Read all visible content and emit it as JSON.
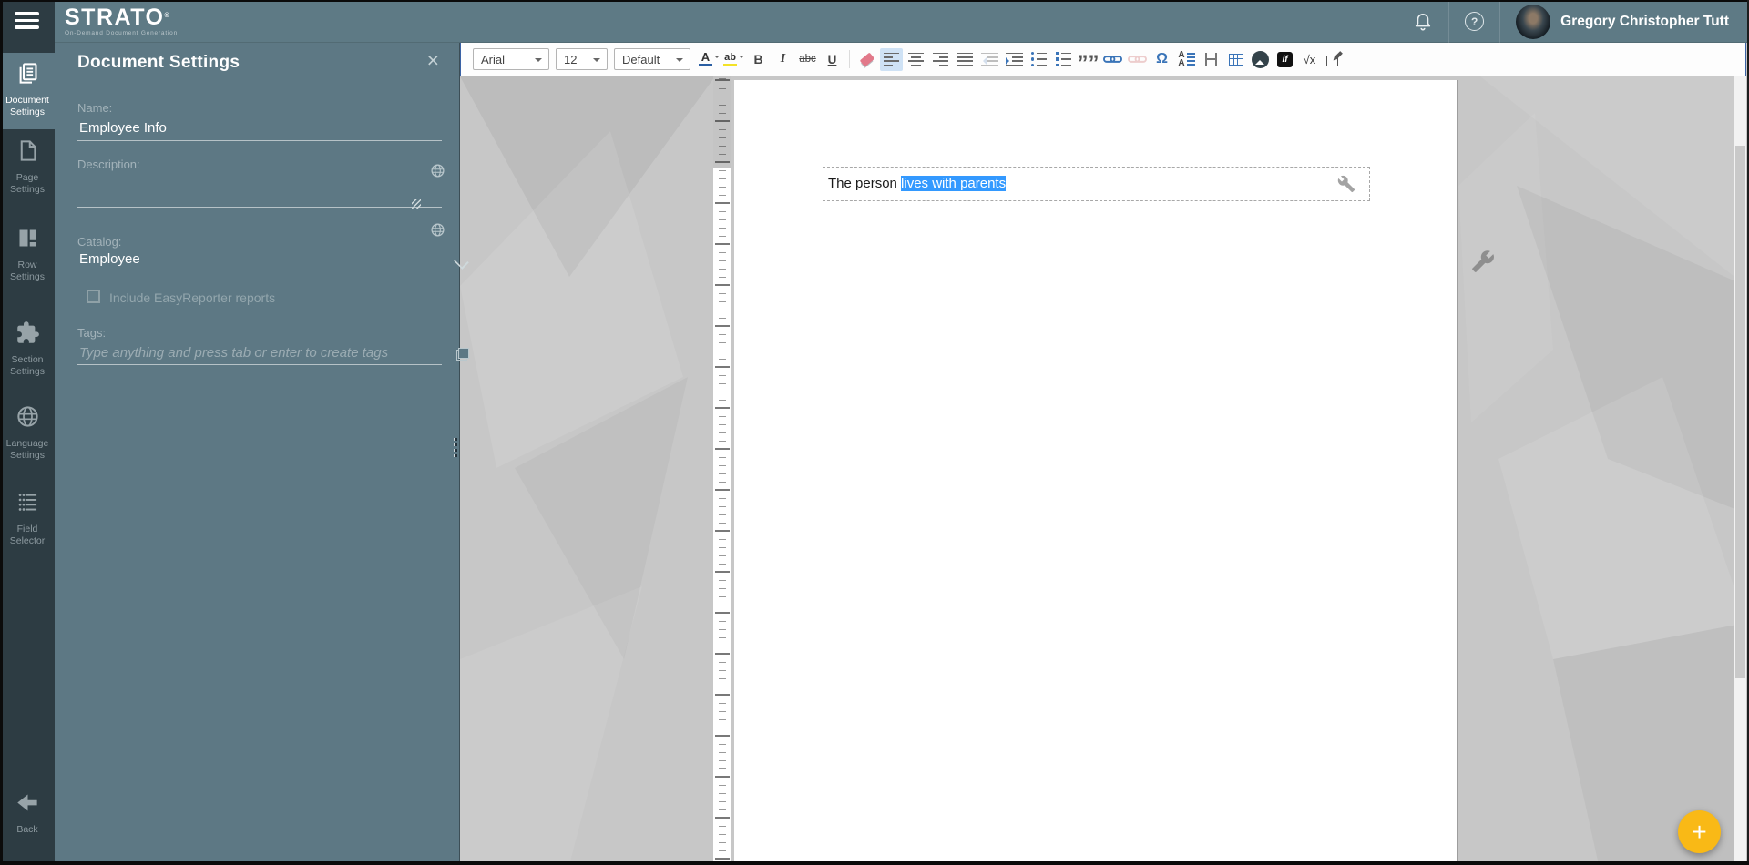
{
  "topbar": {
    "logo_title": "STRATO",
    "logo_tm": "®",
    "logo_subtitle": "On-Demand Document Generation",
    "user_name": "Gregory Christopher Tutt",
    "help_glyph": "?"
  },
  "sidebar": {
    "items": [
      {
        "l1": "Document",
        "l2": "Settings"
      },
      {
        "l1": "Page",
        "l2": "Settings"
      },
      {
        "l1": "Row",
        "l2": "Settings"
      },
      {
        "l1": "Section",
        "l2": "Settings"
      },
      {
        "l1": "Language",
        "l2": "Settings"
      },
      {
        "l1": "Field",
        "l2": "Selector"
      }
    ],
    "back_label": "Back"
  },
  "panel": {
    "title": "Document Settings",
    "close_glyph": "×",
    "name_label": "Name:",
    "name_value": "Employee Info",
    "description_label": "Description:",
    "description_value": "",
    "catalog_label": "Catalog:",
    "catalog_value": "Employee",
    "checkbox_label": "Include EasyReporter reports",
    "checkbox_checked": false,
    "tags_label": "Tags:",
    "tags_placeholder": "Type anything and press tab or enter to create tags"
  },
  "toolbar": {
    "font_family": "Arial",
    "font_size": "12",
    "paragraph_style": "Default",
    "fontcolor_glyph": "A",
    "highlight_glyph": "ab",
    "bold_glyph": "B",
    "italic_glyph": "I",
    "strike_glyph": "abc",
    "underline_glyph": "U",
    "quote_glyph": "”",
    "omega_glyph": "Ω",
    "linespace_glyph": "A",
    "if_glyph": "if",
    "formula_glyph": "√x"
  },
  "editor": {
    "text_before": "The person ",
    "text_selected": "lives with parents"
  },
  "fab_plus_glyph": "+",
  "colors": {
    "topbar_bg": "#5e7a85",
    "sidebar_bg": "#2d3c43",
    "panel_bg": "#5d7884",
    "canvas_bg": "#c7c7c7",
    "selection_blue": "#3399ff",
    "accent_blue": "#3a74b8",
    "editor_border_blue": "#3a62a5",
    "fab_yellow": "#f9b916"
  }
}
